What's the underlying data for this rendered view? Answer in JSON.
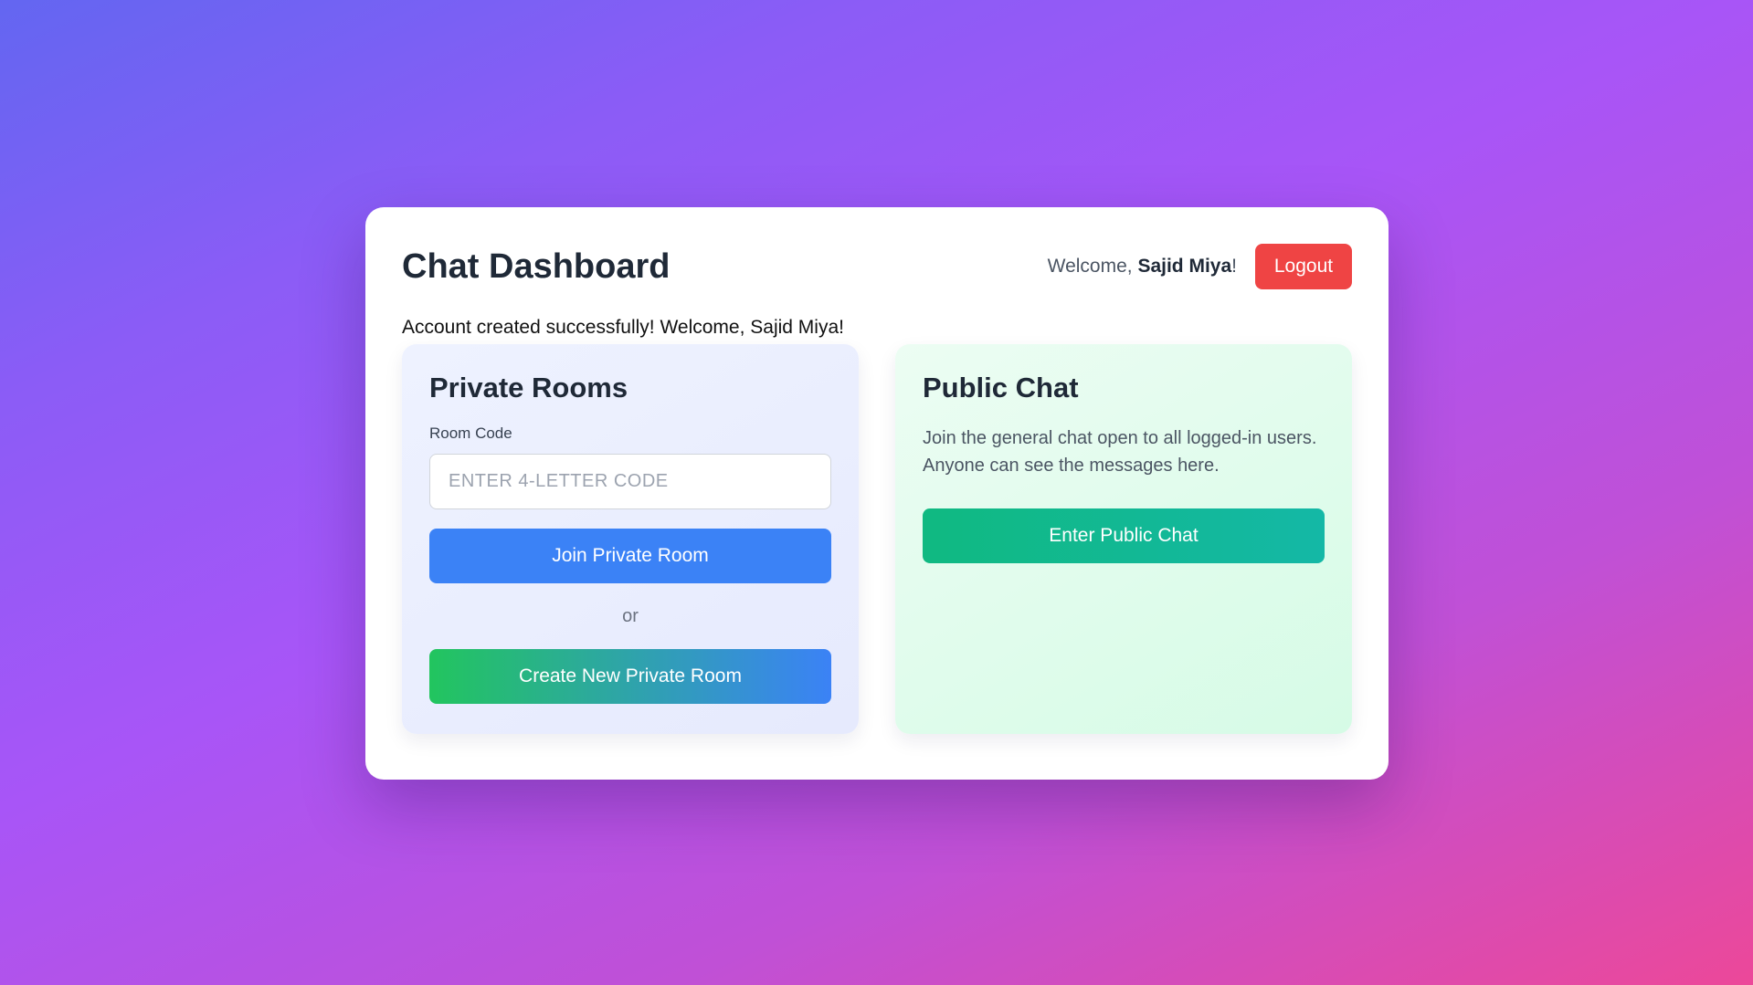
{
  "header": {
    "title": "Chat Dashboard",
    "welcome_prefix": "Welcome, ",
    "user_name": "Sajid Miya",
    "welcome_suffix": "!",
    "logout_label": "Logout"
  },
  "flash_message": "Account created successfully! Welcome, Sajid Miya!",
  "private_rooms": {
    "title": "Private Rooms",
    "room_code_label": "Room Code",
    "room_code_placeholder": "ENTER 4-LETTER CODE",
    "room_code_value": "",
    "join_label": "Join Private Room",
    "or_text": "or",
    "create_label": "Create New Private Room"
  },
  "public_chat": {
    "title": "Public Chat",
    "description": "Join the general chat open to all logged-in users. Anyone can see the messages here.",
    "enter_label": "Enter Public Chat"
  },
  "colors": {
    "logout": "#ef4444",
    "join": "#3b82f6",
    "create_start": "#22c55e",
    "create_end": "#3b82f6",
    "public_start": "#10b981",
    "public_end": "#14b8a6"
  }
}
